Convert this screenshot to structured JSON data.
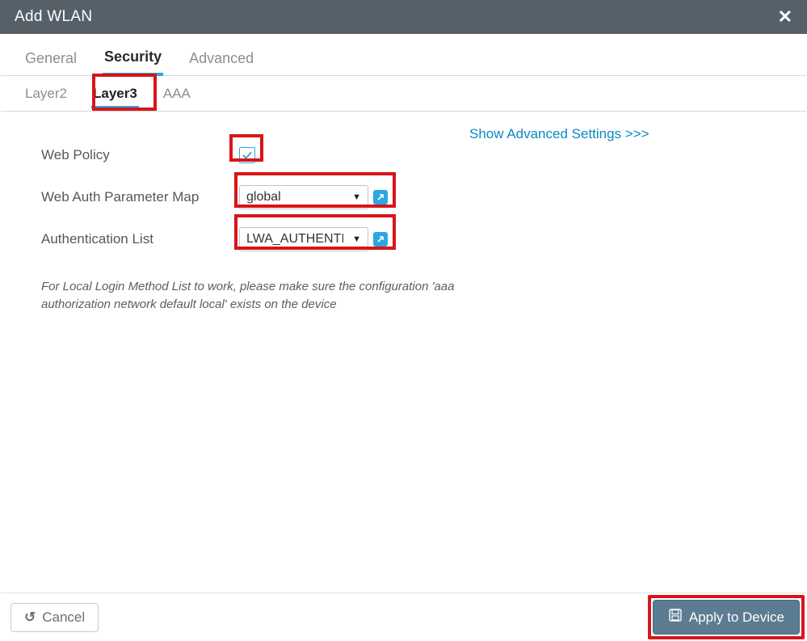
{
  "title": "Add WLAN",
  "tabs_primary": {
    "general": "General",
    "security": "Security",
    "advanced": "Advanced"
  },
  "tabs_secondary": {
    "layer2": "Layer2",
    "layer3": "Layer3",
    "aaa": "AAA"
  },
  "show_advanced": "Show Advanced Settings >>>",
  "form": {
    "web_policy_label": "Web Policy",
    "web_policy_checked": true,
    "param_map_label": "Web Auth Parameter Map",
    "param_map_value": "global",
    "auth_list_label": "Authentication List",
    "auth_list_value": "LWA_AUTHENTIC"
  },
  "help_text": "For Local Login Method List to work, please make sure the configuration 'aaa authorization network default local' exists on the device",
  "footer": {
    "cancel": "Cancel",
    "apply": "Apply to Device"
  }
}
